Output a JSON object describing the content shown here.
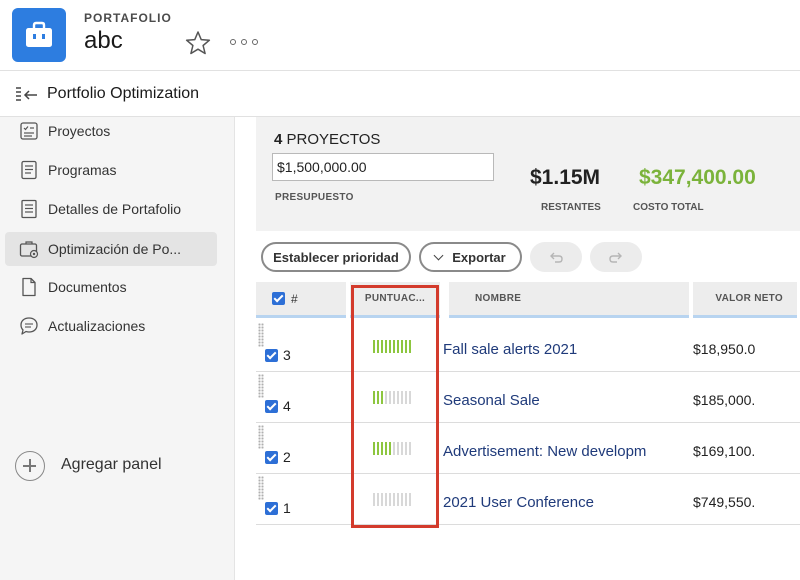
{
  "header": {
    "kicker": "PORTAFOLIO",
    "title": "abc",
    "logo_icon": "briefcase-icon",
    "accent": "#2d7de0"
  },
  "titlebar": {
    "title": "Portfolio Optimization"
  },
  "sidebar": {
    "items": [
      {
        "label": "Proyectos",
        "icon": "projects-icon",
        "active": false
      },
      {
        "label": "Programas",
        "icon": "programs-icon",
        "active": false
      },
      {
        "label": "Detalles de Portafolio",
        "icon": "details-icon",
        "active": false
      },
      {
        "label": "Optimización de Po...",
        "icon": "optimization-icon",
        "active": true
      },
      {
        "label": "Documentos",
        "icon": "documents-icon",
        "active": false
      },
      {
        "label": "Actualizaciones",
        "icon": "updates-icon",
        "active": false
      }
    ],
    "add_panel_label": "Agregar panel"
  },
  "summary": {
    "count": "4",
    "count_label": "PROYECTOS",
    "budget_value": "$1,500,000.00",
    "budget_label": "PRESUPUESTO",
    "remaining_value": "$1.15M",
    "remaining_label": "RESTANTES",
    "cost_value": "$347,400.00",
    "cost_label": "COSTO TOTAL",
    "cost_color": "#7bb33b"
  },
  "toolbar": {
    "priority_label": "Establecer prioridad",
    "export_label": "Exportar"
  },
  "table": {
    "columns": {
      "num": "#",
      "score": "PUNTUAC...",
      "name": "NOMBRE",
      "value": "VALOR NETO"
    },
    "rows": [
      {
        "num": "3",
        "score": 10,
        "name": "Fall sale alerts 2021",
        "value": "$18,950.0",
        "checked": true
      },
      {
        "num": "4",
        "score": 3,
        "name": "Seasonal Sale",
        "value": "$185,000.",
        "checked": true
      },
      {
        "num": "2",
        "score": 5,
        "name": "Advertisement: New developm",
        "value": "$169,100.",
        "checked": true
      },
      {
        "num": "1",
        "score": 0,
        "name": "2021 User Conference",
        "value": "$749,550.",
        "checked": true
      }
    ],
    "score_max": 10,
    "score_color": "#8dc63f"
  },
  "highlight_color": "#d33b2c"
}
